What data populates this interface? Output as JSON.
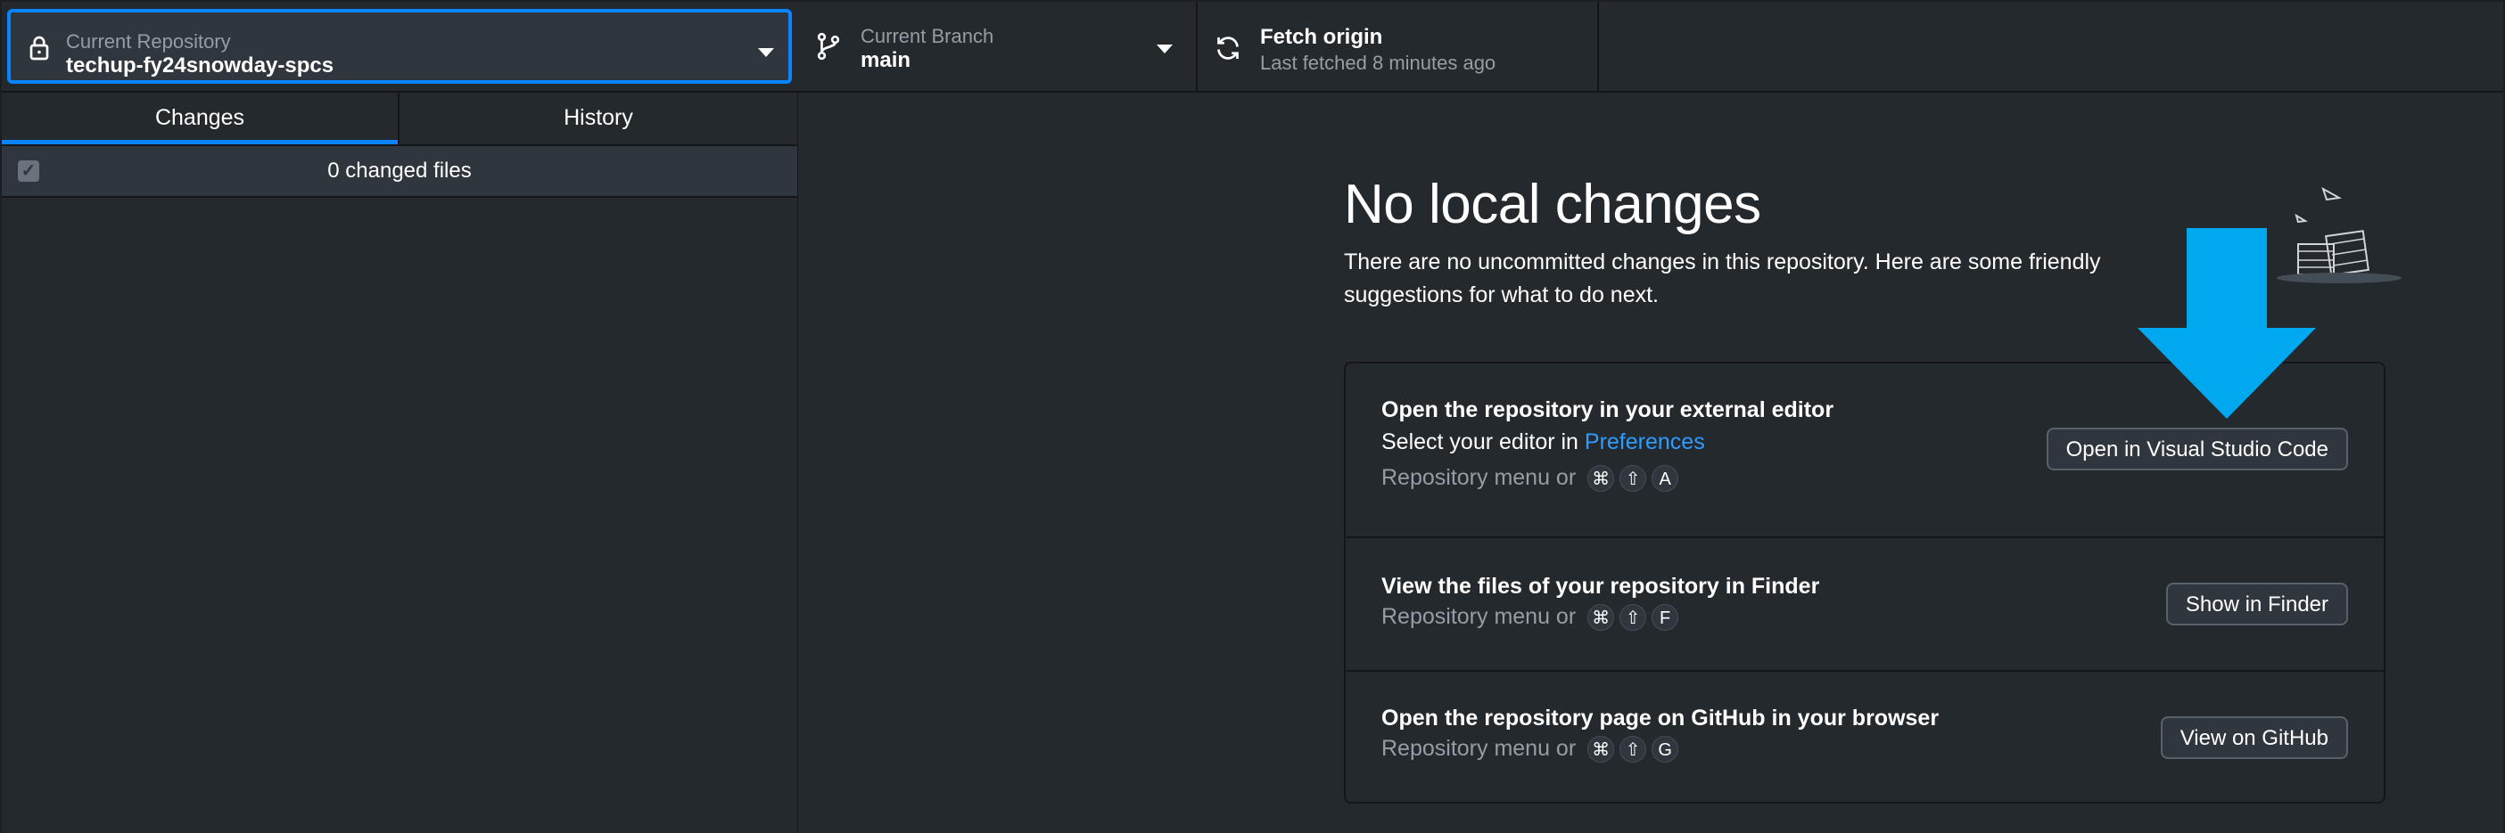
{
  "toolbar": {
    "repository": {
      "caption": "Current Repository",
      "name": "techup-fy24snowday-spcs",
      "icon": "lock-icon"
    },
    "branch": {
      "caption": "Current Branch",
      "name": "main",
      "icon": "git-branch-icon"
    },
    "fetch": {
      "title": "Fetch origin",
      "subtitle": "Last fetched 8 minutes ago",
      "icon": "sync-icon"
    }
  },
  "sidebar": {
    "tabs": [
      {
        "label": "Changes",
        "selected": true
      },
      {
        "label": "History",
        "selected": false
      }
    ],
    "changed_files": "0 changed files"
  },
  "main": {
    "title": "No local changes",
    "description": "There are no uncommitted changes in this repository. Here are some friendly suggestions for what to do next.",
    "actions": [
      {
        "title": "Open the repository in your external editor",
        "subtitle_prefix": "Select your editor in ",
        "subtitle_link": "Preferences",
        "hint": "Repository menu or",
        "keys": [
          "⌘",
          "⇧",
          "A"
        ],
        "button": "Open in Visual Studio Code"
      },
      {
        "title": "View the files of your repository in Finder",
        "hint": "Repository menu or",
        "keys": [
          "⌘",
          "⇧",
          "F"
        ],
        "button": "Show in Finder"
      },
      {
        "title": "Open the repository page on GitHub in your browser",
        "hint": "Repository menu or",
        "keys": [
          "⌘",
          "⇧",
          "G"
        ],
        "button": "View on GitHub"
      }
    ]
  },
  "colors": {
    "accent": "#0a84ff",
    "link": "#2f9bff",
    "annotation_arrow": "#00a8f0",
    "background": "#24292e"
  }
}
